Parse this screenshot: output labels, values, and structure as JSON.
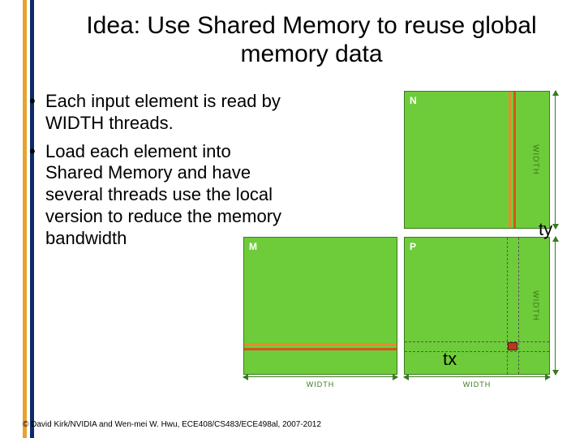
{
  "title": "Idea: Use Shared Memory to reuse global memory data",
  "bullets": [
    "Each input element is read by WIDTH threads.",
    "Load each element into Shared Memory and have several threads use the local version to reduce the memory bandwidth"
  ],
  "diagram": {
    "blocks": {
      "N": {
        "label": "N",
        "side_label": "WIDTH"
      },
      "M": {
        "label": "M"
      },
      "P": {
        "label": "P",
        "side_label": "WIDTH"
      }
    },
    "width_label_M": "WIDTH",
    "width_label_P": "WIDTH",
    "ty_label": "ty",
    "tx_label": "tx"
  },
  "copyright": "© David Kirk/NVIDIA and Wen-mei W. Hwu, ECE408/CS483/ECE498al, 2007-2012"
}
